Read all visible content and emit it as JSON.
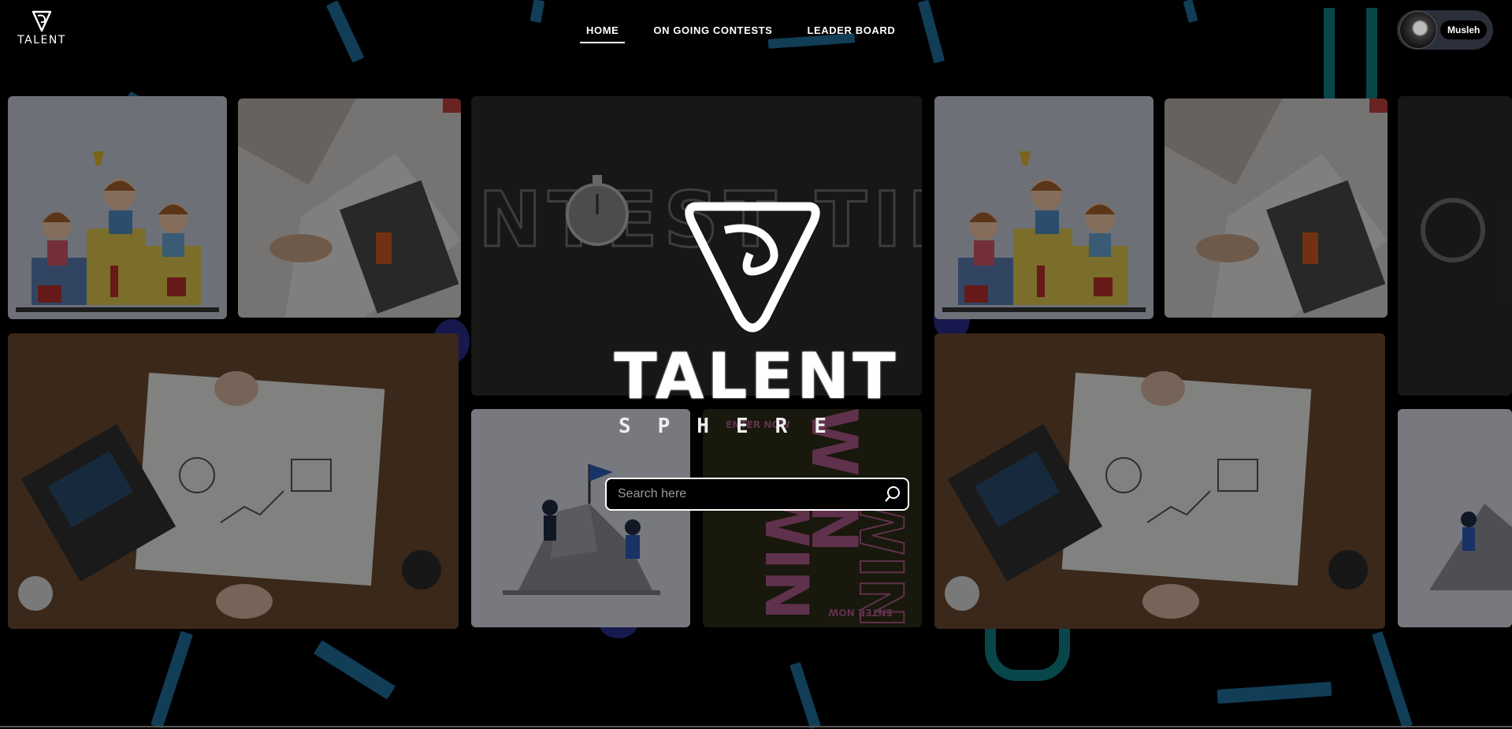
{
  "brand": {
    "logo_text": "TALENT",
    "title": "TALENT",
    "subtitle": "SPHERE"
  },
  "nav": {
    "items": [
      {
        "label": "HOME",
        "active": true
      },
      {
        "label": "ON GOING CONTESTS",
        "active": false
      },
      {
        "label": "LEADER BOARD",
        "active": false
      }
    ]
  },
  "user": {
    "name": "Musleh"
  },
  "search": {
    "placeholder": "Search here",
    "value": "",
    "icon": "search-icon"
  },
  "gallery": {
    "contest_time_text": "CONTEST TIME",
    "win_text": "WIN",
    "enter_now_text": "ENTER NOW"
  },
  "colors": {
    "background": "#000000",
    "confetti_blue": "#1f6f9e",
    "confetti_teal": "#0f8088",
    "confetti_indigo": "#2a2f8f",
    "win_pink": "#b05a8a",
    "win_panel": "#2c2d16"
  }
}
